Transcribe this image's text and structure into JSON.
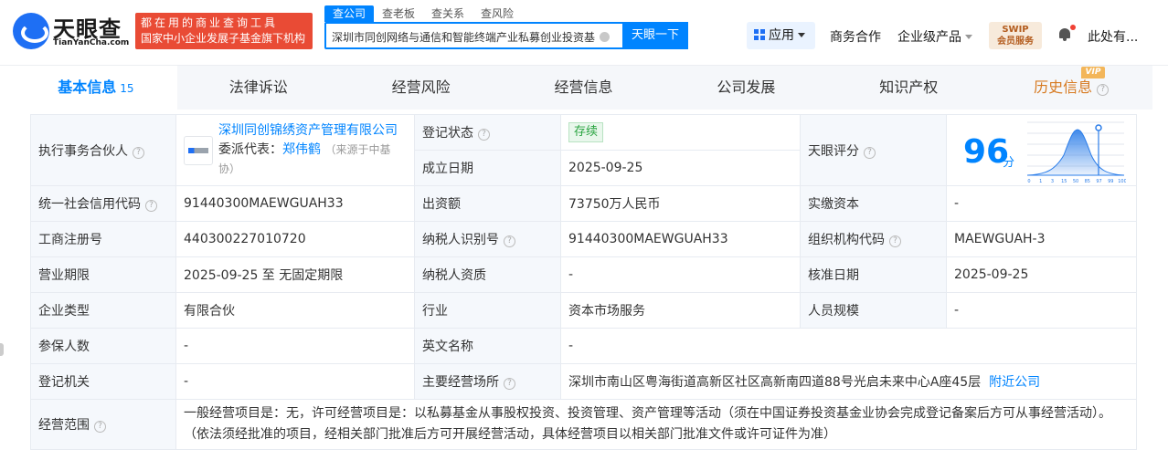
{
  "logo": {
    "title": "天眼查",
    "subtitle": "TianYanCha.com"
  },
  "banner": {
    "line1": "都在用的商业查询工具",
    "line2": "国家中小企业发展子基金旗下机构"
  },
  "search": {
    "tabs": [
      "查公司",
      "查老板",
      "查关系",
      "查风险"
    ],
    "value": "深圳市同创网络与通信和智能终端产业私募创业投资基金",
    "button": "天眼一下"
  },
  "nav": {
    "app": "应用",
    "business": "商务合作",
    "enterprise": "企业级产品",
    "svip_top": "SWIP",
    "svip_bottom": "会员服务",
    "user": "此处有..."
  },
  "tabs": [
    {
      "label": "基本信息",
      "count": "15"
    },
    {
      "label": "法律诉讼"
    },
    {
      "label": "经营风险"
    },
    {
      "label": "经营信息"
    },
    {
      "label": "公司发展"
    },
    {
      "label": "知识产权"
    },
    {
      "label": "历史信息",
      "badge": "VIP"
    }
  ],
  "info": {
    "partner_label": "执行事务合伙人",
    "partner_name": "深圳同创锦绣资产管理有限公司",
    "delegate_label": "委派代表：",
    "delegate_name": "郑伟鹤",
    "delegate_source_a": "（来源于中基",
    "delegate_source_b": "协）",
    "reg_status_label": "登记状态",
    "reg_status": "存续",
    "found_date_label": "成立日期",
    "found_date": "2025-09-25",
    "score_label": "天眼评分",
    "score": "96",
    "score_unit": "分",
    "score_axis": [
      "0",
      "1",
      "3",
      "15",
      "50",
      "85",
      "97",
      "99",
      "100"
    ],
    "credit_code_label": "统一社会信用代码",
    "credit_code": "91440300MAEWGUAH33",
    "capital_label": "出资额",
    "capital": "73750万人民币",
    "paid_capital_label": "实缴资本",
    "paid_capital": "-",
    "reg_no_label": "工商注册号",
    "reg_no": "440300227010720",
    "taxpayer_id_label": "纳税人识别号",
    "taxpayer_id": "91440300MAEWGUAH33",
    "org_code_label": "组织机构代码",
    "org_code": "MAEWGUAH-3",
    "term_label": "营业期限",
    "term": "2025-09-25 至 无固定期限",
    "taxpayer_qual_label": "纳税人资质",
    "taxpayer_qual": "-",
    "approve_date_label": "核准日期",
    "approve_date": "2025-09-25",
    "type_label": "企业类型",
    "type": "有限合伙",
    "industry_label": "行业",
    "industry": "资本市场服务",
    "staff_label": "人员规模",
    "staff": "-",
    "insured_label": "参保人数",
    "insured": "-",
    "english_name_label": "英文名称",
    "english_name": "-",
    "authority_label": "登记机关",
    "authority": "-",
    "address_label": "主要经营场所",
    "address": "深圳市南山区粤海街道高新区社区高新南四道88号光启未来中心A座45层",
    "nearby": "附近公司",
    "scope_label": "经营范围",
    "scope": "一般经营项目是：无，许可经营项目是：以私募基金从事股权投资、投资管理、资产管理等活动（须在中国证券投资基金业协会完成登记备案后方可从事经营活动）。（依法须经批准的项目，经相关部门批准后方可开展经营活动，具体经营项目以相关部门批准文件或许可证件为准）"
  },
  "colors": {
    "accent": "#0084ff",
    "brand_red": "#e94b35",
    "status_green": "#2aa441",
    "history_orange": "#d77a21"
  }
}
